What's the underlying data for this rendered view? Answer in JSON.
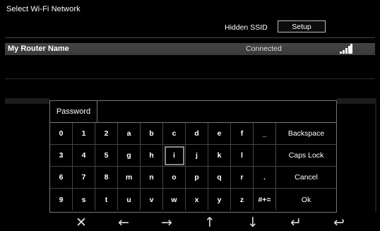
{
  "header": {
    "title": "Select Wi-Fi Network",
    "hidden_ssid_label": "Hidden SSID",
    "setup_label": "Setup"
  },
  "network": {
    "name": "My Router Name",
    "status": "Connected",
    "signal_bars": 5
  },
  "keyboard": {
    "field_label": "Password",
    "field_value": "",
    "rows": [
      [
        "0",
        "1",
        "2",
        "a",
        "b",
        "c",
        "d",
        "e",
        "f",
        "_",
        "Backspace"
      ],
      [
        "3",
        "4",
        "5",
        "g",
        "h",
        "i",
        "j",
        "k",
        "l",
        "",
        "Caps Lock"
      ],
      [
        "6",
        "7",
        "8",
        "m",
        "n",
        "o",
        "p",
        "q",
        "r",
        ".",
        "Cancel"
      ],
      [
        "9",
        "s",
        "t",
        "u",
        "v",
        "w",
        "x",
        "y",
        "z",
        "#+=",
        "Ok"
      ]
    ],
    "selected_key": "i"
  },
  "nav_icons": [
    "close-icon",
    "arrow-left-icon",
    "arrow-right-icon",
    "arrow-up-icon",
    "arrow-down-icon",
    "enter-icon",
    "back-icon"
  ]
}
